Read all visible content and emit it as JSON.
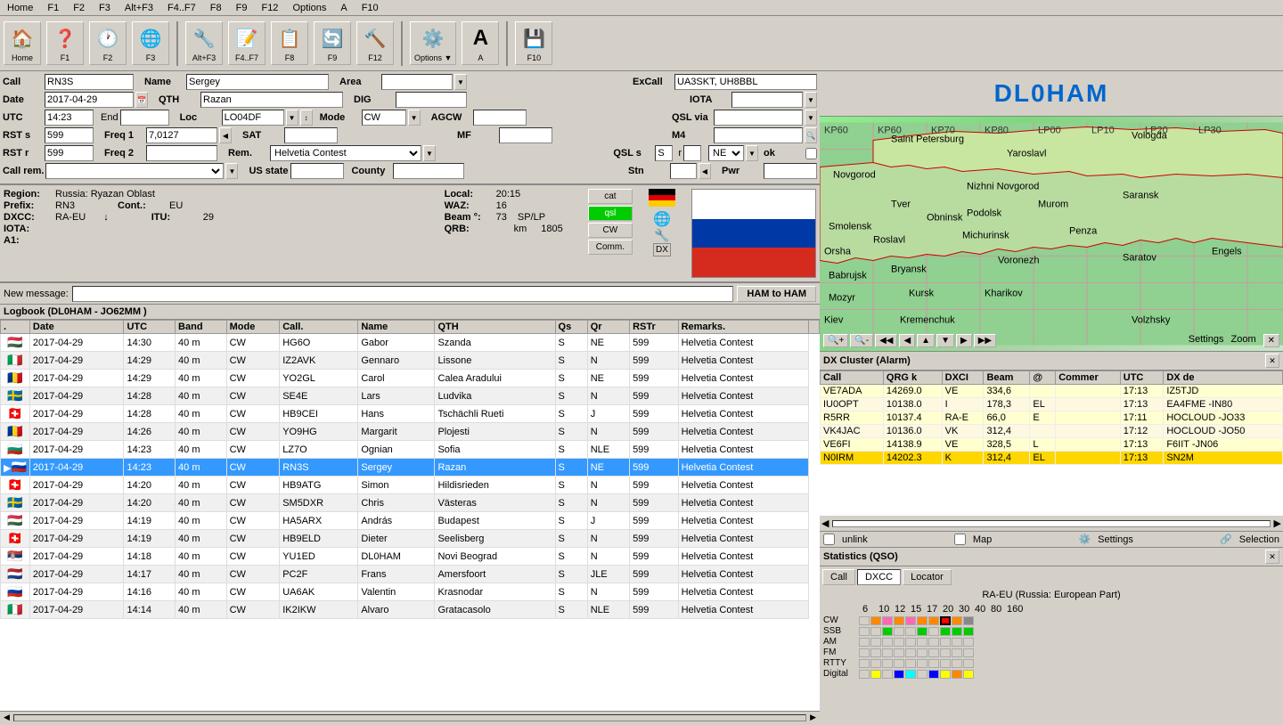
{
  "app": {
    "title": "DL0HAM",
    "subtitle": "DL0HAM",
    "station_call": "DL0HAM",
    "locator": "JO62MM"
  },
  "menubar": {
    "items": [
      "Home",
      "F1",
      "F2",
      "F3",
      "Alt+F3",
      "F4..F7",
      "F8",
      "F9",
      "F12",
      "Options",
      "A",
      "F10"
    ]
  },
  "toolbar": {
    "buttons": [
      {
        "id": "home",
        "icon": "🏠",
        "label": "Home"
      },
      {
        "id": "help",
        "icon": "❓",
        "label": "F1"
      },
      {
        "id": "clock",
        "icon": "🕐",
        "label": "F2"
      },
      {
        "id": "globe",
        "icon": "🌐",
        "label": "F3"
      },
      {
        "id": "tools",
        "icon": "🔧",
        "label": "Alt+F3"
      },
      {
        "id": "edit",
        "icon": "📝",
        "label": "F4..F7"
      },
      {
        "id": "qsl",
        "icon": "📋",
        "label": "F8"
      },
      {
        "id": "refresh",
        "icon": "🔄",
        "label": "F9"
      },
      {
        "id": "wrench",
        "icon": "🔨",
        "label": "F12"
      },
      {
        "id": "options",
        "icon": "⚙️",
        "label": "Options"
      },
      {
        "id": "font",
        "icon": "A",
        "label": "A"
      },
      {
        "id": "save",
        "icon": "💾",
        "label": "F10"
      }
    ]
  },
  "form": {
    "call": "RN3S",
    "name": "Sergey",
    "area": "",
    "excall": "UA3SKT, UH8BBL",
    "date": "2017-04-29",
    "qth": "Razan",
    "dig": "",
    "iota": "",
    "utc": "14:23",
    "end": "",
    "loc": "LO04DF",
    "mode": "CW",
    "agcw": "",
    "qsl_via": "",
    "rst_s": "599",
    "freq1": "7,0127",
    "sat": "",
    "mf": "",
    "m4": "",
    "rst_r": "599",
    "freq2": "",
    "rem": "Helvetia Contest",
    "qsl_s": "S",
    "qsl_r": "",
    "ne": "NE",
    "ok": "",
    "stn": "",
    "pwr": "",
    "call_rem": "",
    "us_state": "",
    "county": ""
  },
  "qso_info": {
    "region": "Russia: Ryazan Oblast",
    "prefix": "RN3",
    "cont": "EU",
    "dxcc": "RA-EU",
    "iota": "",
    "a1": "",
    "waz": "16",
    "itu": "29",
    "beam": "73",
    "qrb": "1805",
    "local": "20:15",
    "sp_lp": "SP/LP"
  },
  "cat_buttons": [
    "cat",
    "qsl",
    "CW",
    "Comm."
  ],
  "message_bar": {
    "label": "New message:",
    "value": "",
    "button": "HAM to HAM"
  },
  "logbook": {
    "title": "Logbook  (DL0HAM - JO62MM )",
    "columns": [
      ".",
      "Date",
      "UTC",
      "Band",
      "Mode",
      "Call.",
      "Name",
      "QTH",
      "Qs",
      "Qr",
      "RSTr",
      "Remarks."
    ],
    "rows": [
      {
        "flag": "🇭🇺",
        "date": "2017-04-29",
        "utc": "14:30",
        "band": "40 m",
        "mode": "CW",
        "call": "HG6O",
        "name": "Gabor",
        "qth": "Szanda",
        "qs": "S",
        "qr": "NE",
        "rstr": "599",
        "rem": "Helvetia Contest",
        "selected": false
      },
      {
        "flag": "🇮🇹",
        "date": "2017-04-29",
        "utc": "14:29",
        "band": "40 m",
        "mode": "CW",
        "call": "IZ2AVK",
        "name": "Gennaro",
        "qth": "Lissone",
        "qs": "S",
        "qr": "N",
        "rstr": "599",
        "rem": "Helvetia Contest",
        "selected": false
      },
      {
        "flag": "🇷🇴",
        "date": "2017-04-29",
        "utc": "14:29",
        "band": "40 m",
        "mode": "CW",
        "call": "YO2GL",
        "name": "Carol",
        "qth": "Calea  Aradului",
        "qs": "S",
        "qr": "NE",
        "rstr": "599",
        "rem": "Helvetia Contest",
        "selected": false
      },
      {
        "flag": "🇸🇪",
        "date": "2017-04-29",
        "utc": "14:28",
        "band": "40 m",
        "mode": "CW",
        "call": "SE4E",
        "name": "Lars",
        "qth": "Ludvika",
        "qs": "S",
        "qr": "N",
        "rstr": "599",
        "rem": "Helvetia Contest",
        "selected": false
      },
      {
        "flag": "🇨🇭",
        "date": "2017-04-29",
        "utc": "14:28",
        "band": "40 m",
        "mode": "CW",
        "call": "HB9CEI",
        "name": "Hans",
        "qth": "Tschächli Rueti",
        "qs": "S",
        "qr": "J",
        "rstr": "599",
        "rem": "Helvetia Contest",
        "selected": false
      },
      {
        "flag": "🇷🇴",
        "date": "2017-04-29",
        "utc": "14:26",
        "band": "40 m",
        "mode": "CW",
        "call": "YO9HG",
        "name": "Margarit",
        "qth": "Plojesti",
        "qs": "S",
        "qr": "N",
        "rstr": "599",
        "rem": "Helvetia Contest",
        "selected": false
      },
      {
        "flag": "🇧🇬",
        "date": "2017-04-29",
        "utc": "14:23",
        "band": "40 m",
        "mode": "CW",
        "call": "LZ7O",
        "name": "Ognian",
        "qth": "Sofia",
        "qs": "S",
        "qr": "NLE",
        "rstr": "599",
        "rem": "Helvetia Contest",
        "selected": false
      },
      {
        "flag": "🇷🇺",
        "date": "2017-04-29",
        "utc": "14:23",
        "band": "40 m",
        "mode": "CW",
        "call": "RN3S",
        "name": "Sergey",
        "qth": "Razan",
        "qs": "S",
        "qr": "NE",
        "rstr": "599",
        "rem": "Helvetia Contest",
        "selected": true
      },
      {
        "flag": "🇨🇭",
        "date": "2017-04-29",
        "utc": "14:20",
        "band": "40 m",
        "mode": "CW",
        "call": "HB9ATG",
        "name": "Simon",
        "qth": "Hildisrieden",
        "qs": "S",
        "qr": "N",
        "rstr": "599",
        "rem": "Helvetia Contest",
        "selected": false
      },
      {
        "flag": "🇸🇪",
        "date": "2017-04-29",
        "utc": "14:20",
        "band": "40 m",
        "mode": "CW",
        "call": "SM5DXR",
        "name": "Chris",
        "qth": "Västeras",
        "qs": "S",
        "qr": "N",
        "rstr": "599",
        "rem": "Helvetia Contest",
        "selected": false
      },
      {
        "flag": "🇭🇺",
        "date": "2017-04-29",
        "utc": "14:19",
        "band": "40 m",
        "mode": "CW",
        "call": "HA5ARX",
        "name": "András",
        "qth": "Budapest",
        "qs": "S",
        "qr": "J",
        "rstr": "599",
        "rem": "Helvetia Contest",
        "selected": false
      },
      {
        "flag": "🇨🇭",
        "date": "2017-04-29",
        "utc": "14:19",
        "band": "40 m",
        "mode": "CW",
        "call": "HB9ELD",
        "name": "Dieter",
        "qth": "Seelisberg",
        "qs": "S",
        "qr": "N",
        "rstr": "599",
        "rem": "Helvetia Contest",
        "selected": false
      },
      {
        "flag": "🇷🇸",
        "date": "2017-04-29",
        "utc": "14:18",
        "band": "40 m",
        "mode": "CW",
        "call": "YU1ED",
        "name": "DL0HAM",
        "qth": "Novi Beograd",
        "qs": "S",
        "qr": "N",
        "rstr": "599",
        "rem": "Helvetia Contest",
        "selected": false
      },
      {
        "flag": "🇳🇱",
        "date": "2017-04-29",
        "utc": "14:17",
        "band": "40 m",
        "mode": "CW",
        "call": "PC2F",
        "name": "Frans",
        "qth": "Amersfoort",
        "qs": "S",
        "qr": "JLE",
        "rstr": "599",
        "rem": "Helvetia Contest",
        "selected": false
      },
      {
        "flag": "🇷🇺",
        "date": "2017-04-29",
        "utc": "14:16",
        "band": "40 m",
        "mode": "CW",
        "call": "UA6AK",
        "name": "Valentin",
        "qth": "Krasnodar",
        "qs": "S",
        "qr": "N",
        "rstr": "599",
        "rem": "Helvetia Contest",
        "selected": false
      },
      {
        "flag": "🇮🇹",
        "date": "2017-04-29",
        "utc": "14:14",
        "band": "40 m",
        "mode": "CW",
        "call": "IK2IKW",
        "name": "Alvaro",
        "qth": "Gratacasolo",
        "qs": "S",
        "qr": "NLE",
        "rstr": "599",
        "rem": "Helvetia Contest",
        "selected": false
      }
    ]
  },
  "dx_cluster": {
    "title": "DX Cluster (Alarm)",
    "columns": [
      "Call",
      "QRG k",
      "DXCI",
      "Beam",
      "@",
      "Commer",
      "UTC",
      "DX de"
    ],
    "rows": [
      {
        "call": "VE7ADA",
        "qrg": "14269.0",
        "dxci": "VE",
        "beam": "334,6",
        "at": "",
        "comm": "",
        "utc": "17:13",
        "dxde": "IZ5TJD"
      },
      {
        "call": "IU0OPT",
        "qrg": "10138.0",
        "dxci": "I",
        "beam": "178,3",
        "at": "EL",
        "comm": "",
        "utc": "17:13",
        "dxde": "EA4FME -IN80"
      },
      {
        "call": "R5RR",
        "qrg": "10137.4",
        "dxci": "RA-E",
        "beam": "66,0",
        "at": "E",
        "comm": "",
        "utc": "17:11",
        "dxde": "HOCLOUD -JO33"
      },
      {
        "call": "VK4JAC",
        "qrg": "10136.0",
        "dxci": "VK",
        "beam": "312,4",
        "at": "",
        "comm": "",
        "utc": "17:12",
        "dxde": "HOCLOUD -JO50"
      },
      {
        "call": "VE6FI",
        "qrg": "14138.9",
        "dxci": "VE",
        "beam": "328,5",
        "at": "L",
        "comm": "",
        "utc": "17:13",
        "dxde": "F6IIT -JN06"
      },
      {
        "call": "N0IRM",
        "qrg": "14202.3",
        "dxci": "K",
        "beam": "312,4",
        "at": "EL",
        "comm": "",
        "utc": "17:13",
        "dxde": "SN2M"
      }
    ]
  },
  "statistics": {
    "title": "Statistics (QSO)",
    "tabs": [
      "Call",
      "DXCC",
      "Locator"
    ],
    "active_tab": "DXCC",
    "label": "RA-EU (Russia: European Part)",
    "freq_labels": [
      "6",
      "10",
      "15",
      "17",
      "20",
      "30",
      "40",
      "80",
      "160"
    ],
    "modes": [
      "CW",
      "SSB",
      "AM",
      "FM",
      "RTTY",
      "Digital"
    ]
  },
  "map": {
    "settings_label": "Settings",
    "zoom_label": "Zoom"
  }
}
